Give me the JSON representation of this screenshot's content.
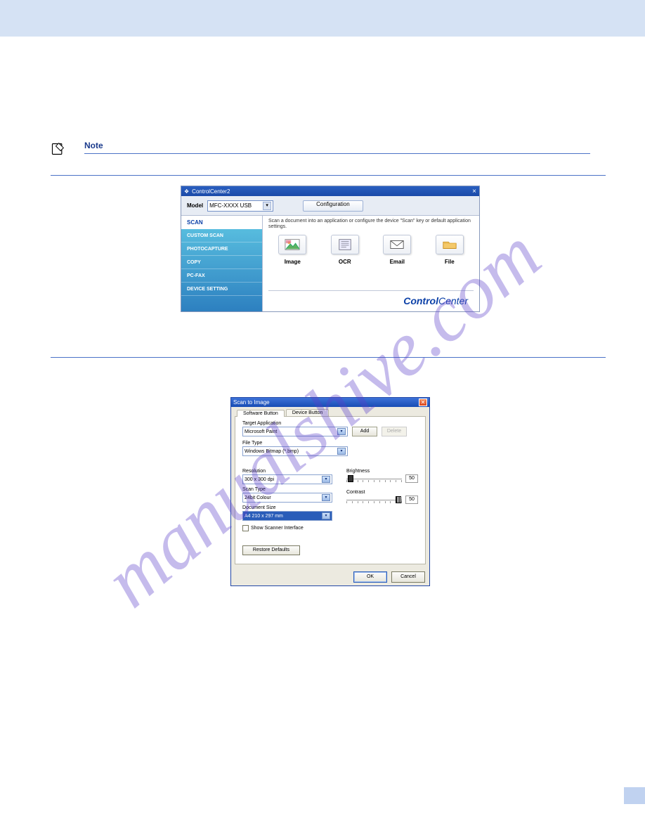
{
  "watermark": "manualshive.com",
  "note_heading": "Note",
  "note_text": "",
  "cc2": {
    "title": "ControlCenter2",
    "model_label": "Model",
    "model_value": "MFC-XXXX USB",
    "config_label": "Configuration",
    "sidebar": [
      {
        "label": "SCAN",
        "active": true
      },
      {
        "label": "CUSTOM SCAN",
        "active": false
      },
      {
        "label": "PHOTOCAPTURE",
        "active": false
      },
      {
        "label": "COPY",
        "active": false
      },
      {
        "label": "PC-FAX",
        "active": false
      },
      {
        "label": "DEVICE SETTING",
        "active": false
      }
    ],
    "desc": "Scan a document into an application or configure the device \"Scan\" key or default application settings.",
    "tiles": [
      {
        "label": "Image"
      },
      {
        "label": "OCR"
      },
      {
        "label": "Email"
      },
      {
        "label": "File"
      }
    ],
    "brand_bold": "Control",
    "brand_light": " Center"
  },
  "dlg": {
    "title": "Scan to Image",
    "tabs": [
      {
        "label": "Software Button",
        "active": true
      },
      {
        "label": "Device Button",
        "active": false
      }
    ],
    "target_app_label": "Target Application",
    "target_app_value": "Microsoft Paint",
    "add_label": "Add",
    "delete_label": "Delete",
    "file_type_label": "File Type",
    "file_type_value": "Windows Bitmap (*.bmp)",
    "resolution_label": "Resolution",
    "resolution_value": "300 x 300 dpi",
    "scantype_label": "Scan Type",
    "scantype_value": "24bit Colour",
    "docsize_label": "Document Size",
    "docsize_value": "A4 210 x 297 mm",
    "brightness_label": "Brightness",
    "brightness_value": "50",
    "contrast_label": "Contrast",
    "contrast_value": "50",
    "show_iface_label": "Show Scanner Interface",
    "restore_label": "Restore Defaults",
    "ok_label": "OK",
    "cancel_label": "Cancel"
  }
}
